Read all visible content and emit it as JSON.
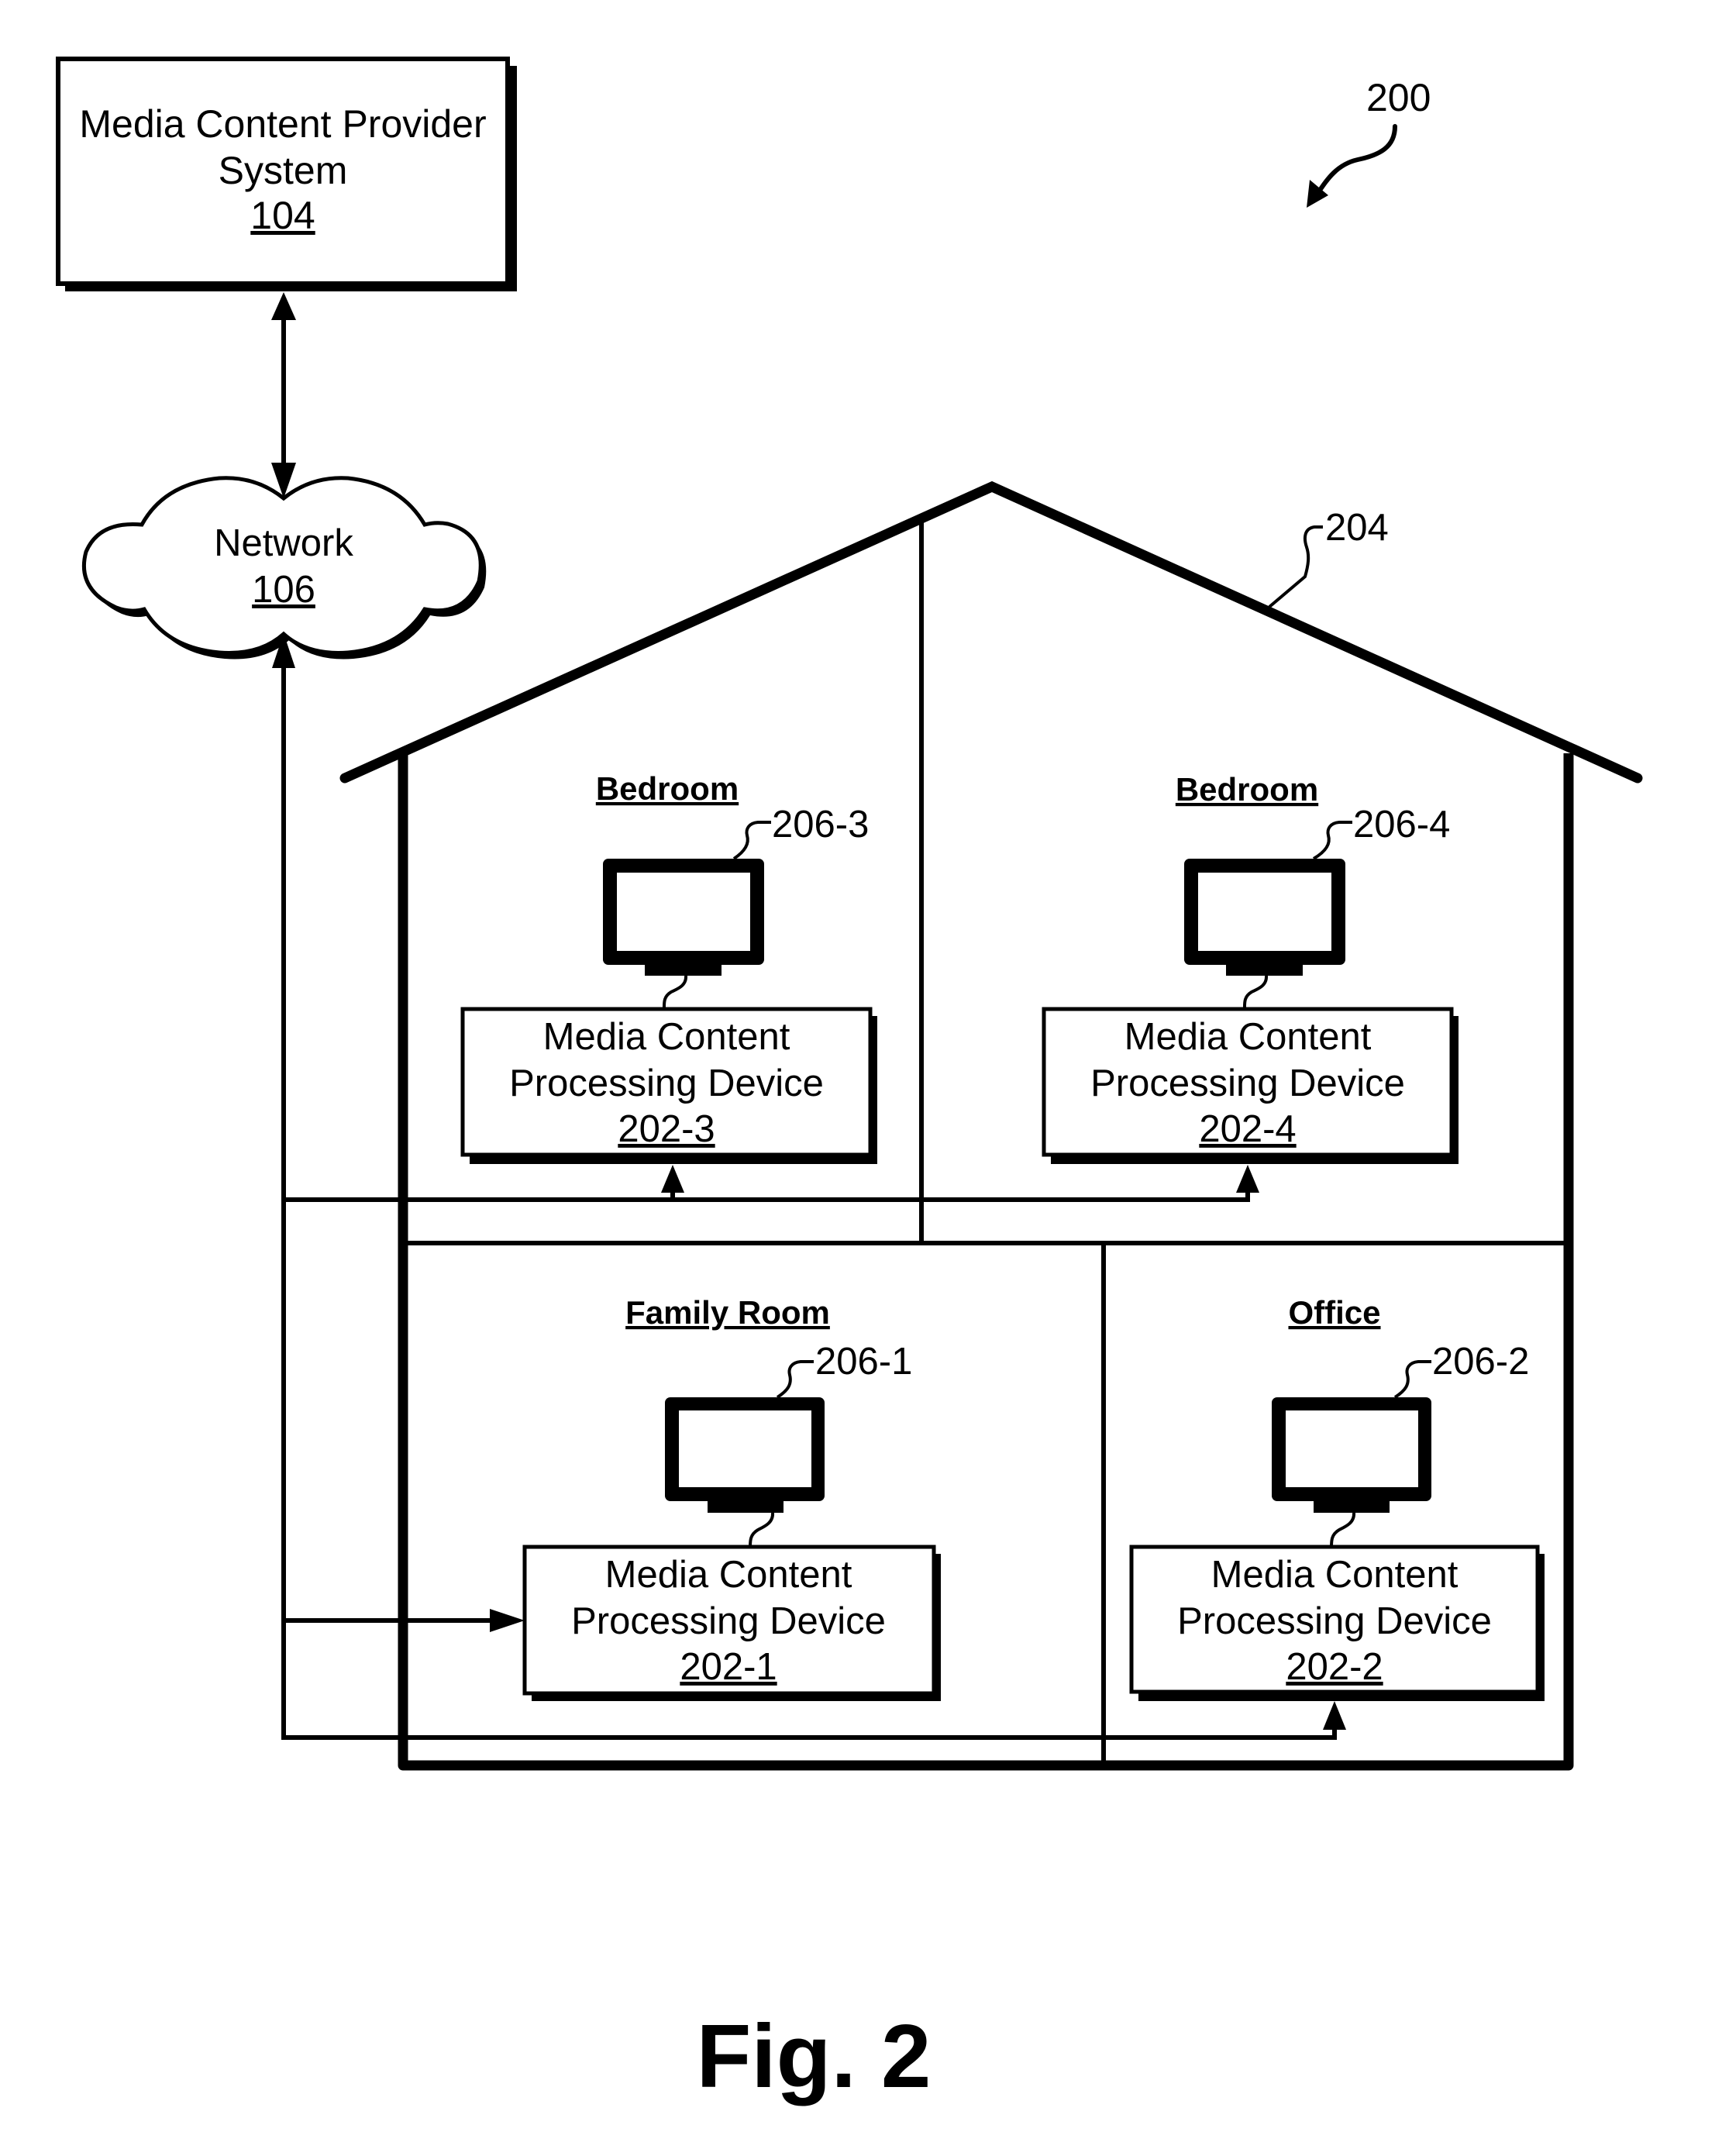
{
  "figure": {
    "ref_number": "200",
    "caption": "Fig. 2"
  },
  "provider": {
    "line1": "Media Content Provider",
    "line2": "System",
    "ref": "104"
  },
  "network": {
    "label": "Network",
    "ref": "106"
  },
  "house": {
    "ref": "204"
  },
  "rooms": [
    {
      "name": "Bedroom",
      "display_ref": "206-3",
      "device": {
        "line1": "Media Content",
        "line2": "Processing Device",
        "ref": "202-3"
      }
    },
    {
      "name": "Bedroom",
      "display_ref": "206-4",
      "device": {
        "line1": "Media Content",
        "line2": "Processing Device",
        "ref": "202-4"
      }
    },
    {
      "name": "Family Room",
      "display_ref": "206-1",
      "device": {
        "line1": "Media Content",
        "line2": "Processing Device",
        "ref": "202-1"
      }
    },
    {
      "name": "Office",
      "display_ref": "206-2",
      "device": {
        "line1": "Media Content",
        "line2": "Processing Device",
        "ref": "202-2"
      }
    }
  ],
  "icons": {
    "display_device": "television-icon",
    "network": "cloud-icon"
  },
  "colors": {
    "ink": "#000000",
    "paper": "#ffffff"
  }
}
